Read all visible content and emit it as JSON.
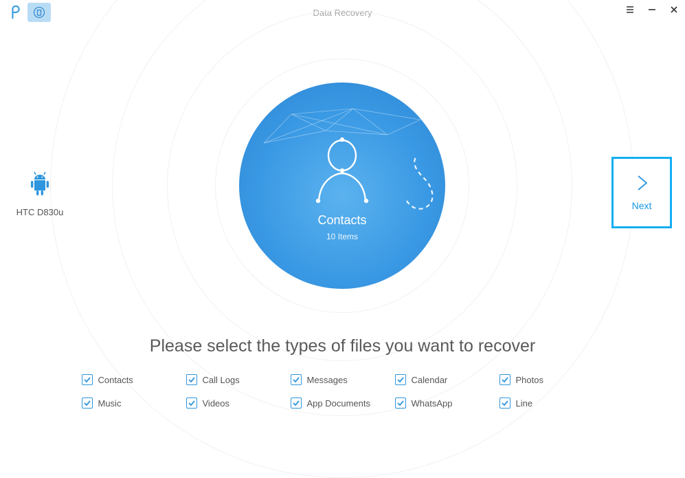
{
  "titlebar": {
    "title": "Data Recovery"
  },
  "device": {
    "name": "HTC D830u"
  },
  "center": {
    "category": "Contacts",
    "item_count": "10 Items"
  },
  "next": {
    "label": "Next"
  },
  "instruction": "Please select the types of files you want to recover",
  "file_types": [
    {
      "label": "Contacts",
      "checked": true
    },
    {
      "label": "Call Logs",
      "checked": true
    },
    {
      "label": "Messages",
      "checked": true
    },
    {
      "label": "Calendar",
      "checked": true
    },
    {
      "label": "Photos",
      "checked": true
    },
    {
      "label": "Music",
      "checked": true
    },
    {
      "label": "Videos",
      "checked": true
    },
    {
      "label": "App Documents",
      "checked": true
    },
    {
      "label": "WhatsApp",
      "checked": true
    },
    {
      "label": "Line",
      "checked": true
    }
  ],
  "colors": {
    "accent": "#2e96de",
    "next_border": "#13aef4"
  }
}
